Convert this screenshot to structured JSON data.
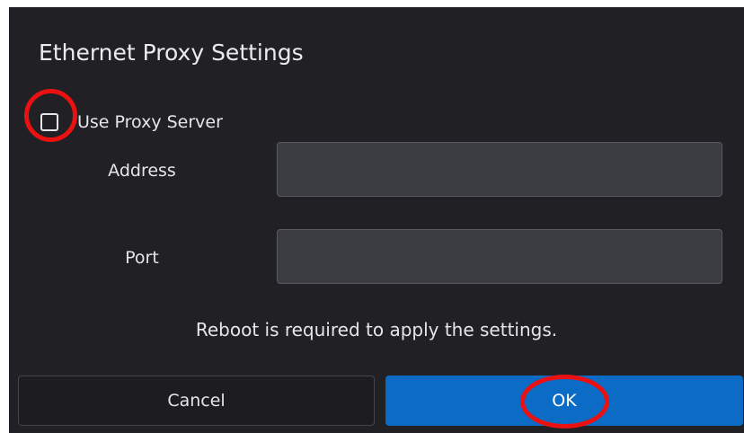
{
  "dialog": {
    "title": "Ethernet Proxy Settings",
    "use_proxy": {
      "label": "Use Proxy Server",
      "checked": false
    },
    "address": {
      "label": "Address",
      "value": ""
    },
    "port": {
      "label": "Port",
      "value": ""
    },
    "note": "Reboot is required to apply the settings.",
    "buttons": {
      "cancel_label": "Cancel",
      "ok_label": "OK"
    }
  },
  "colors": {
    "dialog_background": "#212125",
    "input_background": "#3b3c41",
    "primary_button": "#0b6bc5",
    "highlight_annotation": "#ec1111"
  }
}
